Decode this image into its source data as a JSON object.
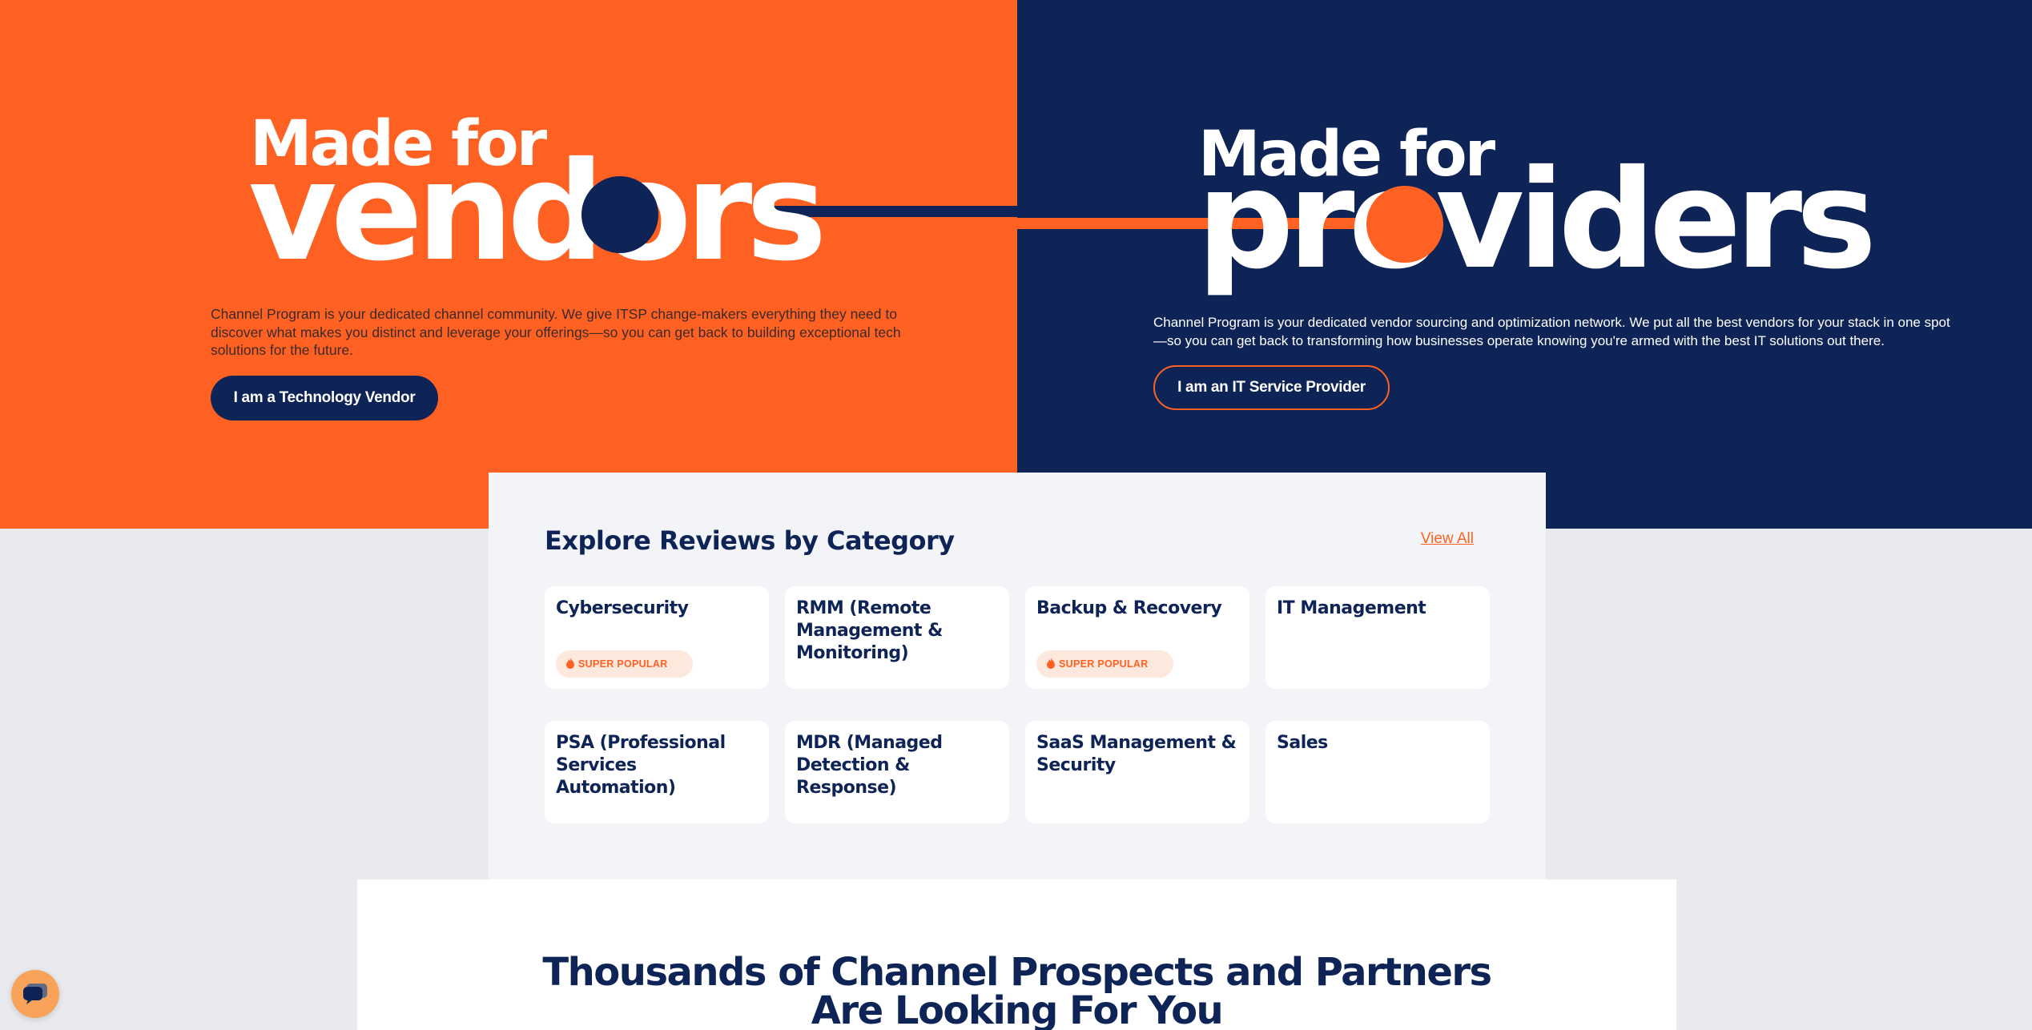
{
  "colors": {
    "orange": "#ff6122",
    "navy": "#0e2356",
    "light_bg": "#f3f4f7"
  },
  "vendors": {
    "headline_small": "Made for",
    "headline_big": "vendors",
    "description": "Channel Program is your dedicated channel community. We give ITSP change-makers everything they need to discover what makes you distinct and leverage your offerings—so you can get back to building exceptional tech solutions for the future.",
    "button_label": "I am a Technology Vendor"
  },
  "providers": {
    "headline_small": "Made for",
    "headline_big": "providers",
    "description": "Channel Program is your dedicated vendor sourcing and optimization network. We put all the best vendors for your stack in one spot—so you can get back to transforming how businesses operate knowing you're armed with the best IT solutions out there.",
    "button_label": "I am an IT Service Provider"
  },
  "explore": {
    "title": "Explore Reviews by Category",
    "view_all": "View All",
    "categories": [
      {
        "title": "Cybersecurity",
        "badge": "SUPER POPULAR"
      },
      {
        "title": "RMM (Remote Management & Monitoring)"
      },
      {
        "title": "Backup & Recovery",
        "badge": "SUPER POPULAR"
      },
      {
        "title": "IT Management"
      },
      {
        "title": "PSA (Professional Services Automation)"
      },
      {
        "title": "MDR (Managed Detection & Response)"
      },
      {
        "title": "SaaS Management & Security"
      },
      {
        "title": "Sales"
      }
    ]
  },
  "prospects": {
    "title_line1": "Thousands of Channel Prospects and Partners",
    "title_line2": "Are Looking For You"
  },
  "chat_widget": {
    "icon": "chat-icon"
  }
}
